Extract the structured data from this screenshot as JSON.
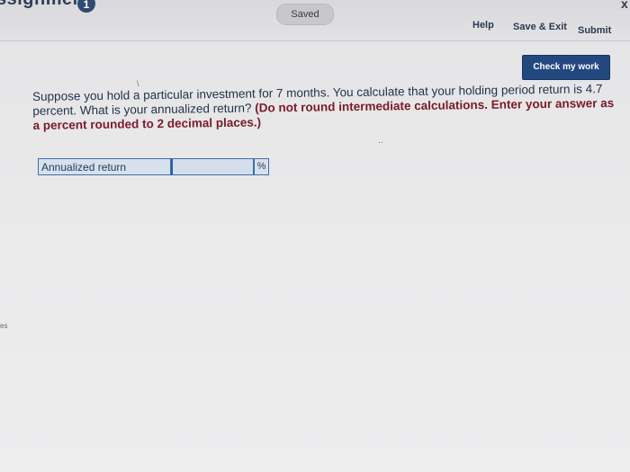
{
  "header": {
    "assignment_title": "ssignment",
    "info_badge": "1",
    "saved_status": "Saved",
    "help_label": "Help",
    "save_exit_label": "Save & Exit",
    "submit_label": "Submit",
    "corner_mark": "x"
  },
  "toolbar": {
    "check_work_label": "Check my work"
  },
  "question": {
    "text": "Suppose you hold a particular investment for 7 months. You calculate that your holding period return is 4.7 percent. What is your annualized return?",
    "hint": "(Do not round intermediate calculations. Enter your answer as a percent rounded to 2 decimal places.)"
  },
  "answer": {
    "label": "Annualized return",
    "value": "",
    "unit": "%"
  },
  "side": {
    "mark": "es"
  },
  "colors": {
    "accent": "#23487f",
    "hint_text": "#7a1a2a",
    "input_border": "#3f6ea9"
  }
}
